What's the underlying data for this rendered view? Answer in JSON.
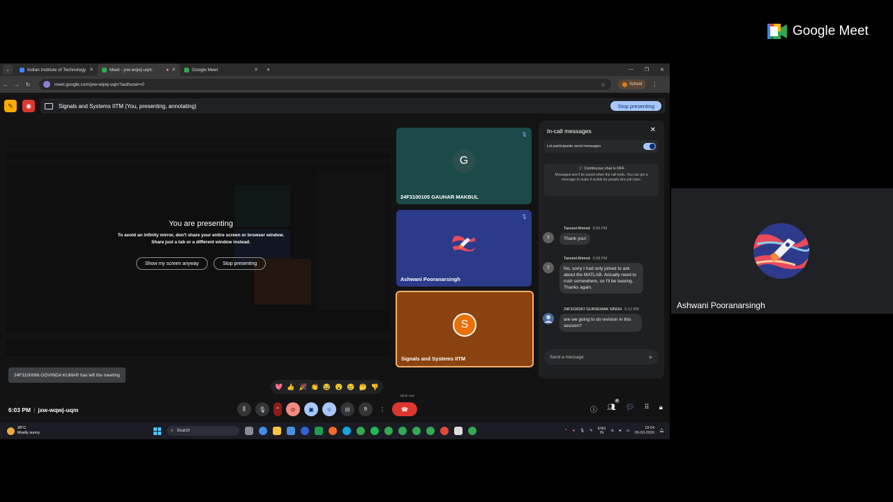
{
  "brand": {
    "text": "Google Meet",
    "colors": [
      "#ea4335",
      "#fbbc04",
      "#34a853",
      "#4285f4"
    ]
  },
  "right_tile": {
    "name": "Ashwani Pooranarsingh"
  },
  "browser": {
    "tabs": [
      {
        "title": "Indian Institute of Technology M",
        "favicon_color": "#4285f4",
        "active": false
      },
      {
        "title": "Meet - jxw-wqwj-uqm",
        "favicon_color": "#34a853",
        "active": true
      },
      {
        "title": "Google Meet",
        "favicon_color": "#34a853",
        "active": false
      }
    ],
    "url": "meet.google.com/jxw-wqwj-uqm?authuser=0",
    "profile": "School"
  },
  "banner": {
    "text": "Signals and Systems IITM (You, presenting, annotating)",
    "stop_label": "Stop presenting"
  },
  "presenting": {
    "title": "You are presenting",
    "line1": "To avoid an infinity mirror, don't share your entire screen or browser window.",
    "line2": "Share just a tab or a different window instead.",
    "show_anyway": "Show my screen anyway",
    "stop": "Stop presenting"
  },
  "participants": [
    {
      "name": "24F3100105 GAUHAR MAKBUL",
      "initial": "G",
      "bg": "#1b4a48",
      "muted": true
    },
    {
      "name": "Ashwani Pooranarsingh",
      "initial": "",
      "bg": "#2b3b8a",
      "muted": true
    },
    {
      "name": "Signals and Systems IITM",
      "initial": "S",
      "bg": "#8a4310",
      "muted": false
    }
  ],
  "chat": {
    "title": "In-call messages",
    "permission": "Let participants send messages",
    "continuous_title": "Continuous chat is OFF",
    "continuous_body": "Messages won't be saved when the call ends. You can pin a message to make it visible for people who join later.",
    "messages": [
      {
        "sender": "Tanzeel Ahmed",
        "time": "5:06 PM",
        "initial": "T",
        "text": "Thank you!"
      },
      {
        "sender": "Tanzeel Ahmed",
        "time": "5:08 PM",
        "initial": "T",
        "text": "No, sorry I had only joined to ask about the MATLAB. Actually need to rush somewhere, so I'll be leaving. Thanks again."
      },
      {
        "sender": "24F3100267 GURSEWAK SINGH",
        "time": "5:12 PM",
        "initial": "",
        "text": "are we going to do revision in this session?"
      }
    ],
    "send_placeholder": "Send a message"
  },
  "toast": "24F3100066 GOVINDA KUMAR has left the meeting",
  "reactions": [
    "💖",
    "👍",
    "🎉",
    "👏",
    "😂",
    "😮",
    "😢",
    "🤔",
    "👎"
  ],
  "bottom": {
    "time": "6:03 PM",
    "code": "jxw-wqwj-uqm",
    "end_tooltip": "Ditch now",
    "people_count": "4"
  },
  "taskbar": {
    "temp": "28°C",
    "weather": "Mostly sunny",
    "search": "Search",
    "lang1": "ENG",
    "lang2": "IN",
    "clock_time": "18:04",
    "clock_date": "09-03-2026"
  }
}
